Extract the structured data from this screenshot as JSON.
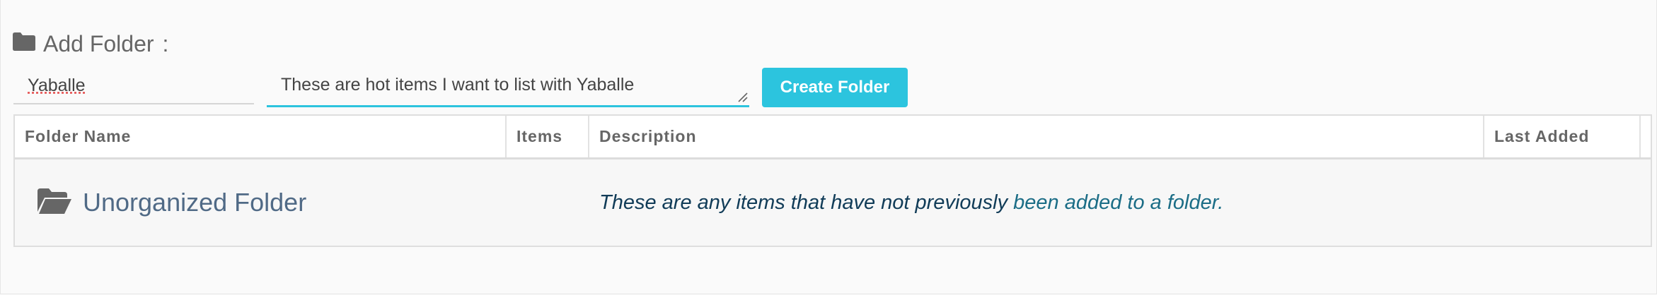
{
  "heading": {
    "label": "Add Folder",
    "colon": ":"
  },
  "form": {
    "name_value": "Yaballe",
    "description_value": "These are hot items I want to list with Yaballe",
    "create_label": "Create Folder"
  },
  "table": {
    "columns": [
      "Folder Name",
      "Items",
      "Description",
      "Last Added",
      ""
    ],
    "rows": [
      {
        "folder_name": "Unorganized Folder",
        "items": "",
        "description_part1": "These are any items that have not previously ",
        "description_part2": "been added to a folder.",
        "last_added": ""
      }
    ]
  },
  "colors": {
    "accent": "#2cc4de",
    "folder_name": "#506a86",
    "description_text": "#113c58"
  },
  "icons": {
    "heading": "folder-icon",
    "row": "folder-open-icon"
  }
}
